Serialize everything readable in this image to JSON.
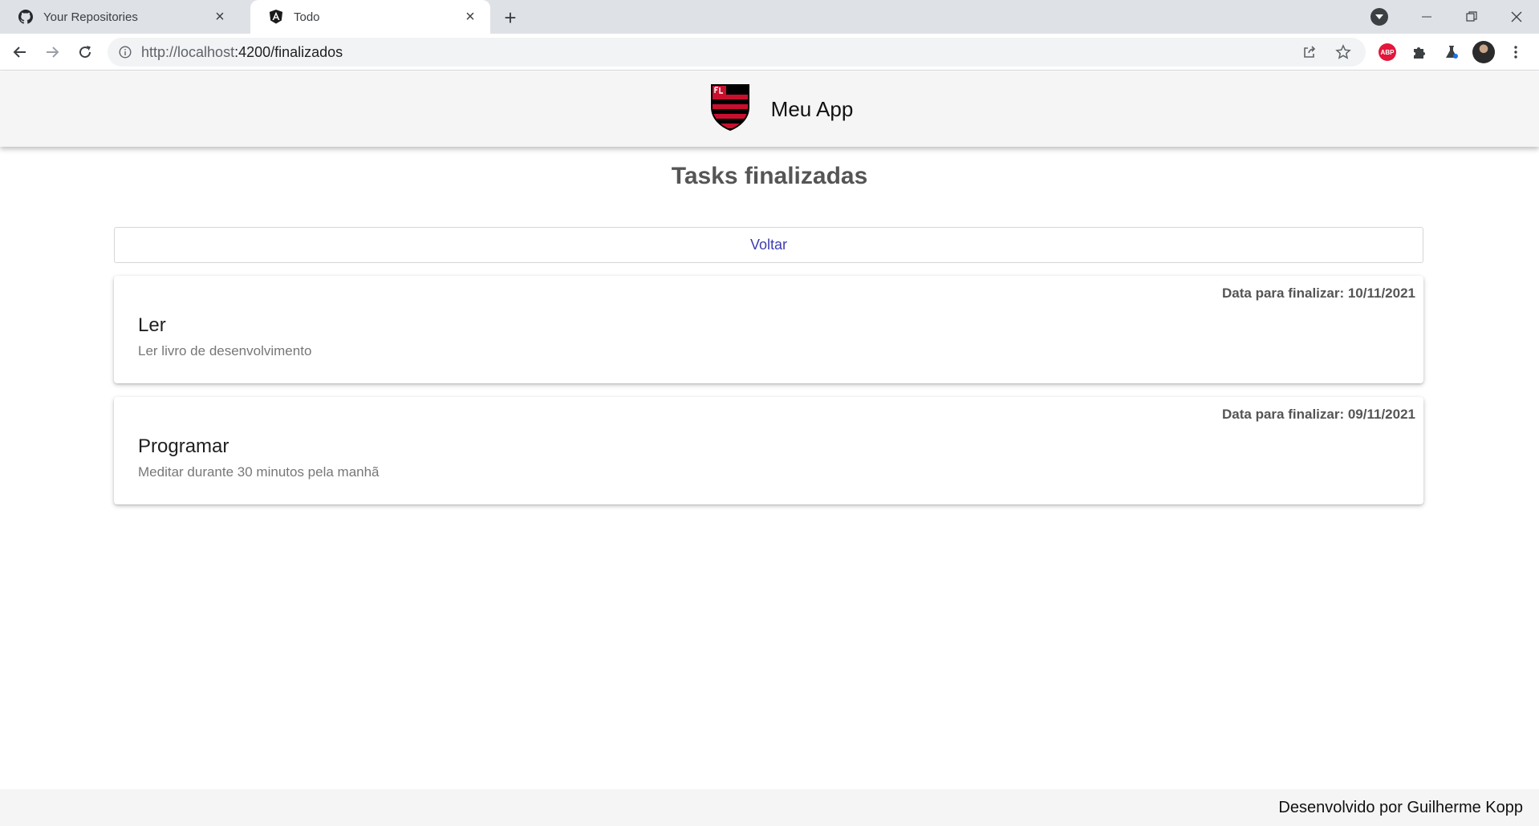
{
  "browser": {
    "tabs": [
      {
        "title": "Your Repositories",
        "icon": "github-icon"
      },
      {
        "title": "Todo",
        "icon": "angular-icon"
      }
    ],
    "url_host": "http://localhost",
    "url_path": ":4200/finalizados",
    "extensions": [
      "adblock-icon",
      "puzzle-icon",
      "labs-icon",
      "avatar"
    ]
  },
  "header": {
    "app_name": "Meu App",
    "logo": "flamengo-crest"
  },
  "page": {
    "title": "Tasks finalizadas",
    "back_label": "Voltar"
  },
  "tasks": [
    {
      "due": "Data para finalizar: 10/11/2021",
      "name": "Ler",
      "description": "Ler livro de desenvolvimento"
    },
    {
      "due": "Data para finalizar: 09/11/2021",
      "name": "Programar",
      "description": "Meditar durante 30 minutos pela manhã"
    }
  ],
  "footer": {
    "text": "Desenvolvido por Guilherme Kopp"
  },
  "colors": {
    "header_bg": "#f5f5f5",
    "title": "#555555",
    "back_link": "#3f3db0",
    "crest_red": "#c8102e",
    "crest_black": "#000000"
  }
}
